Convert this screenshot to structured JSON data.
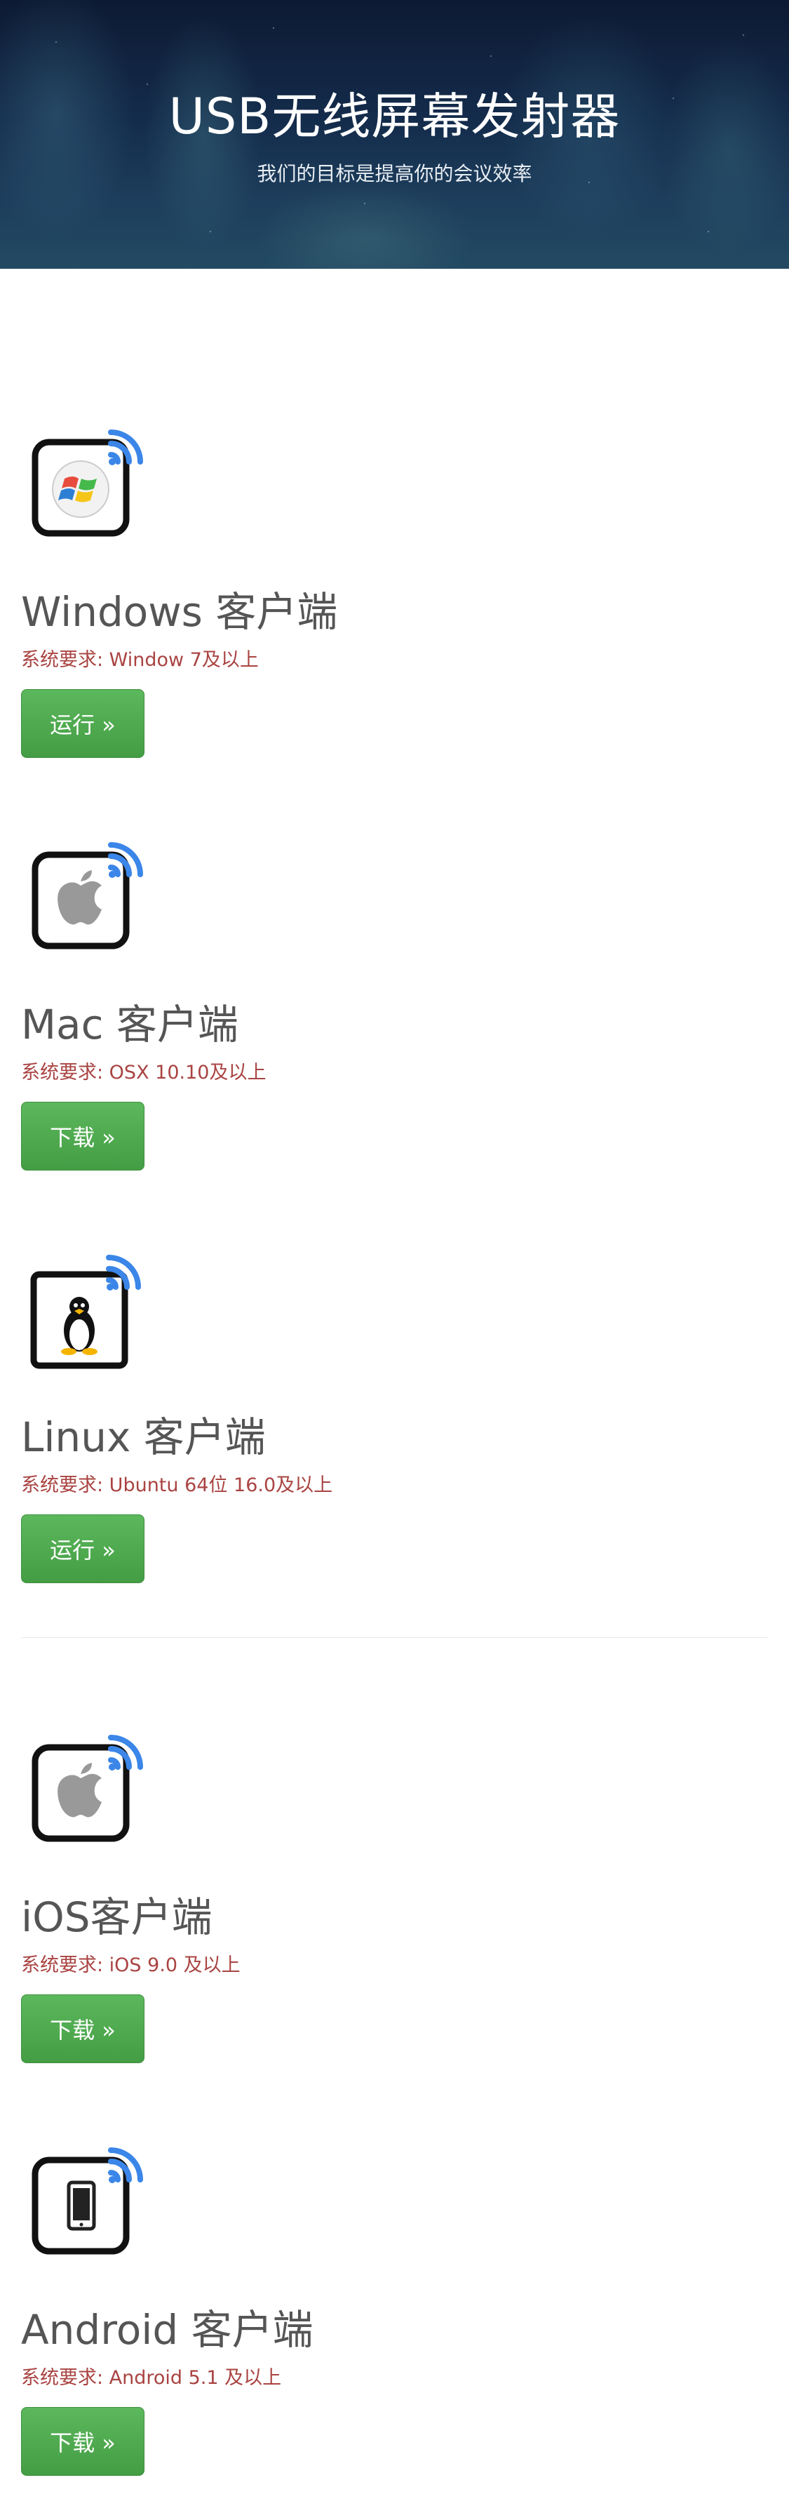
{
  "header": {
    "title": "USB无线屏幕发射器",
    "subtitle": "我们的目标是提高你的会议效率"
  },
  "clients": [
    {
      "name": "Windows 客户端",
      "requirement": "系统要求: Window 7及以上",
      "button": "运行 »",
      "icon": "windows-wifi-icon"
    },
    {
      "name": "Mac 客户端",
      "requirement": "系统要求: OSX 10.10及以上",
      "button": "下载 »",
      "icon": "apple-wifi-icon"
    },
    {
      "name": "Linux 客户端",
      "requirement": "系统要求: Ubuntu 64位 16.0及以上",
      "button": "运行 »",
      "icon": "linux-wifi-icon"
    },
    {
      "name": "iOS客户端",
      "requirement": "系统要求: iOS 9.0 及以上",
      "button": "下载 »",
      "icon": "apple-wifi-icon"
    },
    {
      "name": "Android 客户端",
      "requirement": "系统要求: Android 5.1 及以上",
      "button": "下载 »",
      "icon": "phone-wifi-icon"
    }
  ],
  "colors": {
    "button": "#5cb85c",
    "requirement_text": "#a94442",
    "title_text": "#555555",
    "wifi_signal": "#3b86e8"
  }
}
